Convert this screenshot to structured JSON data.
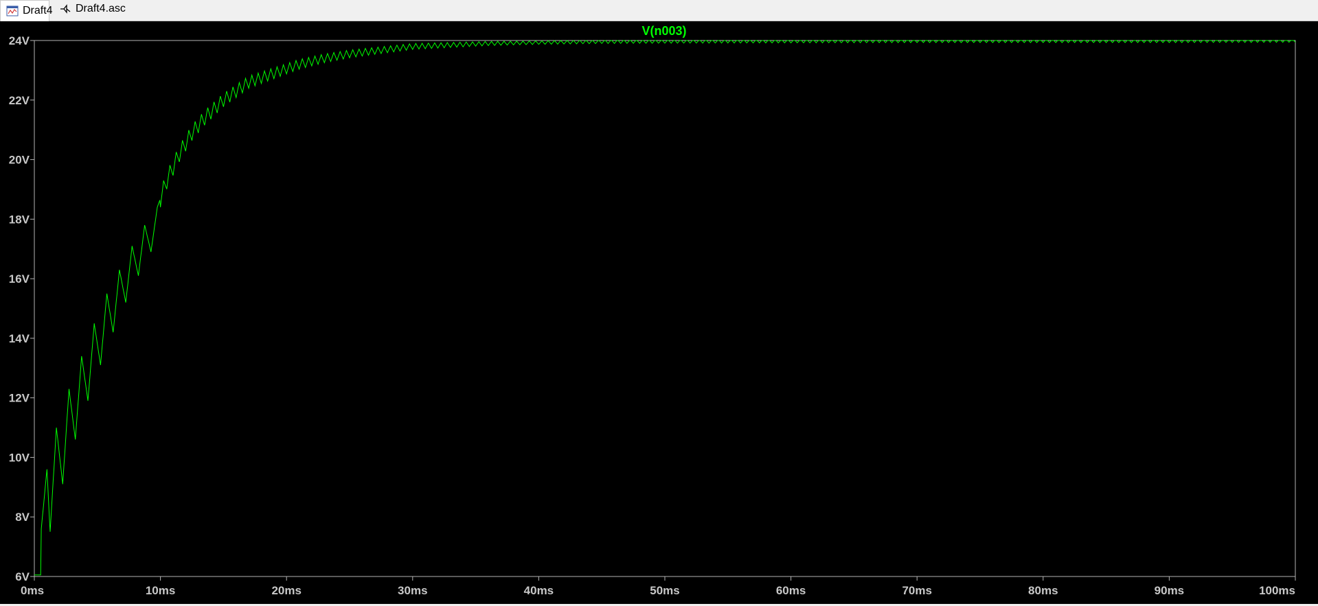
{
  "tabs": [
    {
      "label": "Draft4",
      "icon": "waveform-icon",
      "active": true
    },
    {
      "label": "Draft4.asc",
      "icon": "schematic-icon",
      "active": false
    }
  ],
  "chart_data": {
    "type": "line",
    "title": "V(n003)",
    "xlabel": "",
    "ylabel": "",
    "xlim": [
      0,
      100
    ],
    "ylim": [
      6,
      24
    ],
    "x_unit": "ms",
    "y_unit": "V",
    "x_ticks": [
      "0ms",
      "10ms",
      "20ms",
      "30ms",
      "40ms",
      "50ms",
      "60ms",
      "70ms",
      "80ms",
      "90ms",
      "100ms"
    ],
    "y_ticks": [
      "6V",
      "8V",
      "10V",
      "12V",
      "14V",
      "16V",
      "18V",
      "20V",
      "22V",
      "24V"
    ],
    "grid": false,
    "colors": {
      "background": "#000000",
      "trace": "#00ff00",
      "axis": "#b4b4b4",
      "tick_label": "#c8c8c8",
      "title": "#00ff00"
    },
    "series": [
      {
        "name": "V(n003)",
        "x": [
          0,
          0.5,
          0.55,
          1,
          1.25,
          1.75,
          2.25,
          2.75,
          3.25,
          3.75,
          4.25,
          4.75,
          5.25,
          5.75,
          6.25,
          6.75,
          7.25,
          7.75,
          8.25,
          8.75,
          9.25,
          9.75,
          10.5,
          11.5,
          12.5,
          13.5,
          15,
          17,
          19,
          21,
          23,
          25,
          27,
          30,
          33,
          36,
          40,
          45,
          50,
          60,
          70,
          80,
          90,
          100
        ],
        "y": [
          6.05,
          6.05,
          7.6,
          9.6,
          7.5,
          11.0,
          9.1,
          12.3,
          10.6,
          13.4,
          11.9,
          14.5,
          13.1,
          15.5,
          14.2,
          16.3,
          15.2,
          17.1,
          16.1,
          17.8,
          16.9,
          18.4,
          19.3,
          20.2,
          20.9,
          21.4,
          22.0,
          22.6,
          22.9,
          23.2,
          23.4,
          23.55,
          23.65,
          23.8,
          23.85,
          23.9,
          23.93,
          23.96,
          23.97,
          23.98,
          23.99,
          23.99,
          23.99,
          24.0
        ],
        "ripple_amplitude_V": 0.3,
        "ripple_period_ms": 0.5
      }
    ]
  }
}
